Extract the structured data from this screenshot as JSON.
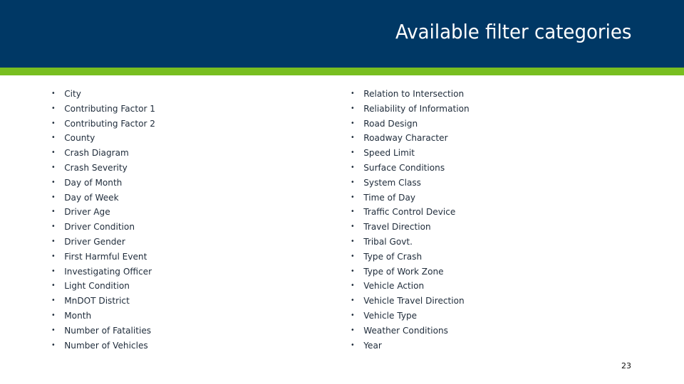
{
  "header": {
    "title": "Available filter categories",
    "colors": {
      "header_bg": "#003865",
      "accent": "#78be20"
    }
  },
  "left_column": {
    "items": [
      "City",
      "Contributing Factor 1",
      "Contributing Factor 2",
      "County",
      "Crash Diagram",
      "Crash Severity",
      "Day of Month",
      "Day of Week",
      "Driver Age",
      "Driver Condition",
      "Driver Gender",
      "First Harmful Event",
      "Investigating Officer",
      "Light Condition",
      "MnDOT District",
      "Month",
      "Number of Fatalities",
      "Number of Vehicles"
    ]
  },
  "right_column": {
    "items": [
      "Relation to Intersection",
      "Reliability of Information",
      "Road Design",
      "Roadway Character",
      "Speed Limit",
      "Surface Conditions",
      "System Class",
      "Time of Day",
      "Traffic Control Device",
      "Travel Direction",
      "Tribal Govt.",
      "Type of Crash",
      "Type of Work Zone",
      "Vehicle Action",
      "Vehicle Travel Direction",
      "Vehicle Type",
      "Weather Conditions",
      "Year"
    ]
  },
  "bullet_glyph": "•",
  "page_number": "23"
}
